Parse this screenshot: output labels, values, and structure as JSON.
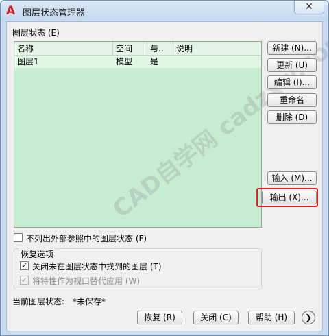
{
  "window": {
    "title": "图层状态管理器",
    "close_glyph": "✕"
  },
  "section_label": "图层状态 (E)",
  "list": {
    "columns": [
      "名称",
      "空间",
      "与..",
      "说明"
    ],
    "rows": [
      {
        "name": "图层1",
        "space": "模型",
        "same": "是",
        "description": ""
      }
    ]
  },
  "buttons": {
    "new": "新建 (N)...",
    "update": "更新 (U)",
    "edit": "编辑 (I)...",
    "rename": "重命名",
    "delete": "删除 (D)",
    "import": "输入 (M)...",
    "export": "输出 (X)..."
  },
  "options": {
    "exclude_xref": {
      "label": "不列出外部参照中的图层状态 (F)",
      "checked": false
    },
    "restore_group_label": "恢复选项",
    "turn_off_layers": {
      "label": "关闭未在图层状态中找到的图层 (T)",
      "checked": true
    },
    "apply_as_viewport": {
      "label": "将特性作为视口替代应用 (W)",
      "checked": true,
      "disabled": true
    }
  },
  "status": {
    "label": "当前图层状态:",
    "value": "*未保存*"
  },
  "footer": {
    "restore": "恢复 (R)",
    "close": "关闭 (C)",
    "help": "帮助 (H)",
    "more_glyph": "❯"
  },
  "watermark": "CAD自学网  cadzxw.com",
  "icons": {
    "app": "autocad-logo-icon"
  },
  "colors": {
    "list_bg": "#c8ecd0",
    "highlight": "#e02020",
    "app_icon": "#d21f1f"
  }
}
